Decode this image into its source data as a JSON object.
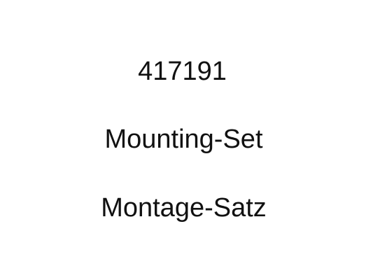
{
  "label": {
    "part_number": "417191",
    "name_en": "Mounting-Set",
    "name_de": "Montage-Satz"
  },
  "colors": {
    "background": "#ffffff",
    "text": "#111111"
  }
}
